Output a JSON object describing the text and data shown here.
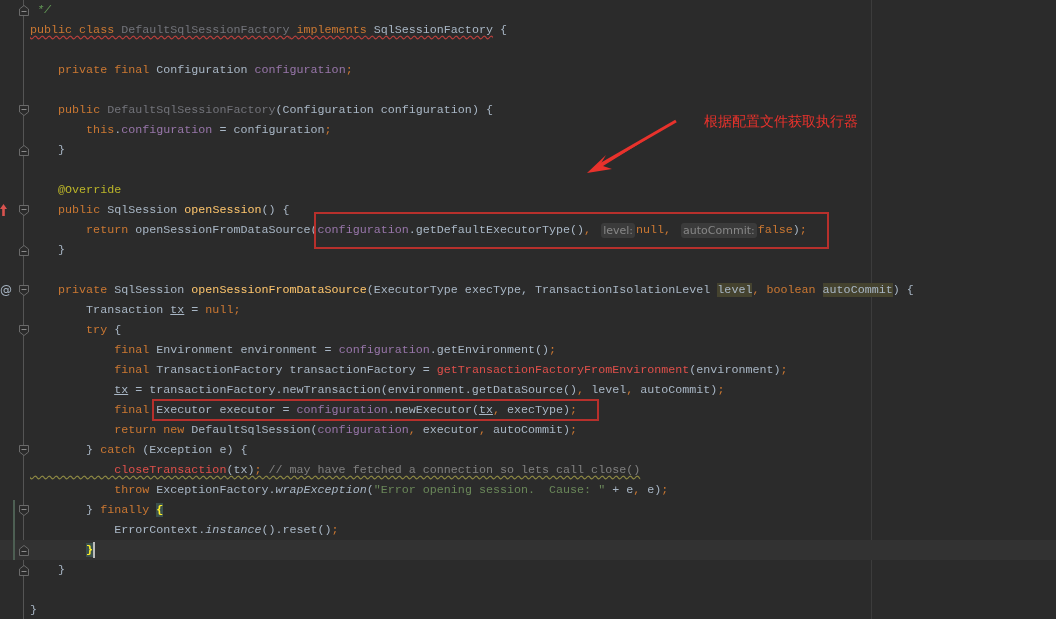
{
  "editor": {
    "lines": [
      {
        "kind": "code",
        "fold_end": true,
        "tokens": [
          {
            "kind": "doc-comment",
            "text": " */"
          }
        ]
      },
      {
        "kind": "code",
        "tokens": [
          {
            "kind": "keyword",
            "text": "public class ",
            "error_underline": true
          },
          {
            "kind": "unused",
            "text": "DefaultSqlSessionFactory",
            "error_underline": true
          },
          {
            "kind": "keyword",
            "text": " implements",
            "error_underline": true
          },
          {
            "kind": "plain",
            "text": " SqlSessionFactory",
            "error_underline": true
          },
          {
            "kind": "plain",
            "text": " {"
          }
        ]
      },
      {
        "kind": "blank"
      },
      {
        "kind": "code",
        "tokens": [
          {
            "kind": "keyword",
            "text": "    private final "
          },
          {
            "kind": "plain",
            "text": "Configuration "
          },
          {
            "kind": "field",
            "text": "configuration"
          },
          {
            "kind": "punct",
            "text": ";"
          }
        ]
      },
      {
        "kind": "blank"
      },
      {
        "kind": "code",
        "fold_start": true,
        "tokens": [
          {
            "kind": "keyword",
            "text": "    public "
          },
          {
            "kind": "unused",
            "text": "DefaultSqlSessionFactory"
          },
          {
            "kind": "plain",
            "text": "(Configuration configuration) {"
          }
        ]
      },
      {
        "kind": "code",
        "tokens": [
          {
            "kind": "keyword",
            "text": "        this"
          },
          {
            "kind": "plain",
            "text": "."
          },
          {
            "kind": "field",
            "text": "configuration"
          },
          {
            "kind": "plain",
            "text": " = configuration"
          },
          {
            "kind": "punct",
            "text": ";"
          }
        ]
      },
      {
        "kind": "code",
        "fold_end": true,
        "tokens": [
          {
            "kind": "plain",
            "text": "    }"
          }
        ]
      },
      {
        "kind": "blank"
      },
      {
        "kind": "code",
        "tokens": [
          {
            "kind": "annotation",
            "text": "    @Override"
          }
        ]
      },
      {
        "kind": "code",
        "fold_start": true,
        "marker": {
          "kind": "overrides"
        },
        "tokens": [
          {
            "kind": "keyword",
            "text": "    public "
          },
          {
            "kind": "plain",
            "text": "SqlSession "
          },
          {
            "kind": "method",
            "text": "openSession"
          },
          {
            "kind": "plain",
            "text": "() {"
          }
        ]
      },
      {
        "kind": "code",
        "tokens": [
          {
            "kind": "keyword",
            "text": "        return "
          },
          {
            "kind": "plain",
            "text": "openSessionFromDataSource("
          },
          {
            "kind": "field",
            "text": "configuration",
            "box_start": true
          },
          {
            "kind": "plain",
            "text": ".getDefaultExecutorType()"
          },
          {
            "kind": "punct",
            "text": ","
          },
          {
            "kind": "hint",
            "text": "level:"
          },
          {
            "kind": "keyword",
            "text": "null"
          },
          {
            "kind": "punct",
            "text": ","
          },
          {
            "kind": "hint",
            "text": "autoCommit:"
          },
          {
            "kind": "keyword",
            "text": "false"
          },
          {
            "kind": "plain",
            "text": ")"
          },
          {
            "kind": "punct",
            "text": ";"
          }
        ]
      },
      {
        "kind": "code",
        "fold_end": true,
        "tokens": [
          {
            "kind": "plain",
            "text": "    }"
          }
        ]
      },
      {
        "kind": "blank"
      },
      {
        "kind": "code",
        "fold_start": true,
        "marker": {
          "kind": "implemented",
          "glyph": "@"
        },
        "tokens": [
          {
            "kind": "keyword",
            "text": "    private "
          },
          {
            "kind": "plain",
            "text": "SqlSession "
          },
          {
            "kind": "method",
            "text": "openSessionFromDataSource"
          },
          {
            "kind": "plain",
            "text": "(ExecutorType execType, TransactionIsolationLevel "
          },
          {
            "kind": "usage",
            "text": "level"
          },
          {
            "kind": "punct",
            "text": ","
          },
          {
            "kind": "keyword",
            "text": " boolean "
          },
          {
            "kind": "usage",
            "text": "autoCommit"
          },
          {
            "kind": "plain",
            "text": ") {"
          }
        ]
      },
      {
        "kind": "code",
        "tokens": [
          {
            "kind": "plain",
            "text": "        Transaction "
          },
          {
            "kind": "reassigned",
            "text": "tx"
          },
          {
            "kind": "plain",
            "text": " = "
          },
          {
            "kind": "keyword",
            "text": "null"
          },
          {
            "kind": "punct",
            "text": ";"
          }
        ]
      },
      {
        "kind": "code",
        "fold_start": true,
        "tokens": [
          {
            "kind": "keyword",
            "text": "        try"
          },
          {
            "kind": "plain",
            "text": " {"
          }
        ]
      },
      {
        "kind": "code",
        "tokens": [
          {
            "kind": "keyword",
            "text": "            final "
          },
          {
            "kind": "plain",
            "text": "Environment environment = "
          },
          {
            "kind": "field",
            "text": "configuration"
          },
          {
            "kind": "plain",
            "text": ".getEnvironment()"
          },
          {
            "kind": "punct",
            "text": ";"
          }
        ]
      },
      {
        "kind": "code",
        "tokens": [
          {
            "kind": "keyword",
            "text": "            final "
          },
          {
            "kind": "plain",
            "text": "TransactionFactory transactionFactory = "
          },
          {
            "kind": "error",
            "text": "getTransactionFactoryFromEnvironment"
          },
          {
            "kind": "plain",
            "text": "(environment)"
          },
          {
            "kind": "punct",
            "text": ";"
          }
        ]
      },
      {
        "kind": "code",
        "tokens": [
          {
            "kind": "reassigned",
            "text": "            tx"
          },
          {
            "kind": "plain",
            "text": " = transactionFactory.newTransaction(environment.getDataSource()"
          },
          {
            "kind": "punct",
            "text": ","
          },
          {
            "kind": "plain",
            "text": " level"
          },
          {
            "kind": "punct",
            "text": ","
          },
          {
            "kind": "plain",
            "text": " autoCommit)"
          },
          {
            "kind": "punct",
            "text": ";"
          }
        ]
      },
      {
        "kind": "code",
        "tokens": [
          {
            "kind": "keyword",
            "text": "            final "
          },
          {
            "kind": "plain",
            "text": "Executor executor = ",
            "box_start": true
          },
          {
            "kind": "field",
            "text": "configuration"
          },
          {
            "kind": "plain",
            "text": ".newExecutor("
          },
          {
            "kind": "reassigned",
            "text": "tx"
          },
          {
            "kind": "punct",
            "text": ","
          },
          {
            "kind": "plain",
            "text": " execType)"
          },
          {
            "kind": "punct",
            "text": ";"
          }
        ]
      },
      {
        "kind": "code",
        "tokens": [
          {
            "kind": "keyword",
            "text": "            return new "
          },
          {
            "kind": "plain",
            "text": "DefaultSqlSession("
          },
          {
            "kind": "field",
            "text": "configuration"
          },
          {
            "kind": "punct",
            "text": ","
          },
          {
            "kind": "plain",
            "text": " executor"
          },
          {
            "kind": "punct",
            "text": ","
          },
          {
            "kind": "plain",
            "text": " autoCommit)"
          },
          {
            "kind": "punct",
            "text": ";"
          }
        ]
      },
      {
        "kind": "code",
        "fold_start": true,
        "tokens": [
          {
            "kind": "plain",
            "text": "        } "
          },
          {
            "kind": "keyword",
            "text": "catch"
          },
          {
            "kind": "plain",
            "text": " (Exception e) {"
          }
        ]
      },
      {
        "kind": "code",
        "tokens": [
          {
            "kind": "error",
            "text": "            closeTransaction",
            "warning_underline": true
          },
          {
            "kind": "plain",
            "text": "(",
            "warning_underline": true
          },
          {
            "kind": "reassigned",
            "text": "tx",
            "warning_underline": true
          },
          {
            "kind": "plain",
            "text": ")",
            "warning_underline": true
          },
          {
            "kind": "punct",
            "text": ";",
            "warning_underline": true
          },
          {
            "kind": "comment",
            "text": " // may have fetched a connection so lets call close()",
            "warning_underline": true
          }
        ]
      },
      {
        "kind": "code",
        "tokens": [
          {
            "kind": "keyword",
            "text": "            throw "
          },
          {
            "kind": "plain",
            "text": "ExceptionFactory."
          },
          {
            "kind": "static",
            "text": "wrapException"
          },
          {
            "kind": "plain",
            "text": "("
          },
          {
            "kind": "string",
            "text": "\"Error opening session.  Cause: \""
          },
          {
            "kind": "plain",
            "text": " + e"
          },
          {
            "kind": "punct",
            "text": ","
          },
          {
            "kind": "plain",
            "text": " e)"
          },
          {
            "kind": "punct",
            "text": ";"
          }
        ]
      },
      {
        "kind": "code",
        "fold_start": true,
        "changed": true,
        "tokens": [
          {
            "kind": "plain",
            "text": "        } "
          },
          {
            "kind": "keyword",
            "text": "finally"
          },
          {
            "kind": "brace-match",
            "text": " {"
          }
        ]
      },
      {
        "kind": "code",
        "changed": true,
        "tokens": [
          {
            "kind": "plain",
            "text": "            ErrorContext."
          },
          {
            "kind": "static",
            "text": "instance"
          },
          {
            "kind": "plain",
            "text": "().reset()"
          },
          {
            "kind": "punct",
            "text": ";"
          }
        ]
      },
      {
        "kind": "code",
        "fold_end": true,
        "changed": true,
        "current": true,
        "tokens": [
          {
            "kind": "brace-match",
            "text": "        }"
          }
        ]
      },
      {
        "kind": "code",
        "fold_end": true,
        "tokens": [
          {
            "kind": "plain",
            "text": "    }"
          }
        ]
      },
      {
        "kind": "blank"
      },
      {
        "kind": "code",
        "tokens": [
          {
            "kind": "plain",
            "text": "}"
          }
        ]
      }
    ]
  },
  "callout": {
    "text": "根据配置文件获取执行器"
  }
}
